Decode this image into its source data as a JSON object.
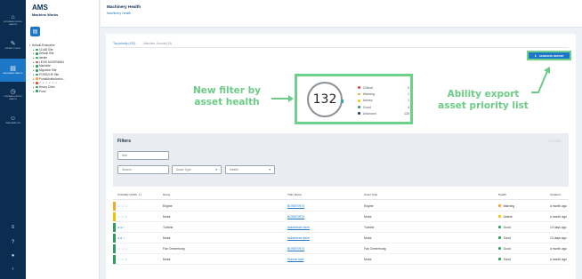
{
  "rail": {
    "items": [
      {
        "icon": "dashboard-icon",
        "glyph": "⌂",
        "label": "EXTENDED DEVICE HEALTH"
      },
      {
        "icon": "wrench-icon",
        "glyph": "✎",
        "label": "EXPERT STUDIO"
      },
      {
        "icon": "site-icon",
        "glyph": "▤",
        "label": "MACHINERY HEALTH"
      },
      {
        "icon": "gauge-icon",
        "glyph": "◷",
        "label": "PORTABLE DEVICE HEALTH"
      },
      {
        "icon": "people-icon",
        "glyph": "☺",
        "label": "USER ANALYSIS"
      }
    ],
    "bottom": [
      {
        "icon": "filter-icon",
        "glyph": "≡"
      },
      {
        "icon": "help-icon",
        "glyph": "?"
      },
      {
        "icon": "user-avatar-icon",
        "glyph": "●"
      },
      {
        "icon": "collapse-icon",
        "glyph": "‹"
      }
    ]
  },
  "brand": {
    "title": "AMS",
    "subtitle": "Machine Works"
  },
  "tree": {
    "toolbar_icon": "list-view-icon",
    "nodes": [
      {
        "label": "Default Enterprise",
        "dot": "",
        "level": 0
      },
      {
        "label": "111AB Site",
        "dot": "#2aa05a",
        "level": 1
      },
      {
        "label": "Default Site",
        "dot": "#2aa05a",
        "level": 1
      },
      {
        "label": "Iterate",
        "dot": "#2aa05a",
        "level": 1
      },
      {
        "label": "LEVIS ACKERMAN",
        "dot": "#d94b3a",
        "level": 1
      },
      {
        "label": "Machsite",
        "dot": "#2aa05a",
        "level": 1
      },
      {
        "label": "Migration Site",
        "dot": "#2aa05a",
        "level": 1
      },
      {
        "label": "PORSCHE Site",
        "dot": "#2aa05a",
        "level": 1
      },
      {
        "label": "PortalMobileArchiv...",
        "dot": "#f5a623",
        "level": 1
      },
      {
        "label": "✓ ✓ ✓ ✓ ✓ ✓",
        "dot": "#d94b3a",
        "level": 1
      },
      {
        "label": "Heavy Clinic",
        "dot": "#2aa05a",
        "level": 1
      },
      {
        "label": "Pond",
        "dot": "#2aa05a",
        "level": 1
      }
    ]
  },
  "header": {
    "title": "Machinery Health",
    "breadcrumb": "Machinery Health"
  },
  "tabs": [
    {
      "label": "Top priority (132)",
      "active": true
    },
    {
      "label": "Machine Journal (13)",
      "active": false
    }
  ],
  "generate_report": {
    "icon": "download-icon",
    "glyph": "⬇",
    "label": "GENERATE REPORT"
  },
  "summary": {
    "total": "132",
    "legend": [
      {
        "label": "Critical",
        "count": "0",
        "color": "#d94b3a"
      },
      {
        "label": "Warning",
        "count": "1",
        "color": "#f5a623"
      },
      {
        "label": "Advise",
        "count": "1",
        "color": "#f5c200"
      },
      {
        "label": "Good",
        "count": "4",
        "color": "#2aa05a"
      },
      {
        "label": "Unknown",
        "count": "126",
        "color": "#1c3d6e"
      }
    ]
  },
  "callouts": {
    "left": "New filter by asset health",
    "right": "Ability export asset priority list"
  },
  "filters": {
    "title": "Filters",
    "clear_label": "CLEAR",
    "chip_value": "Site",
    "search_placeholder": "Search",
    "asset_type_placeholder": "Asset Type",
    "health_placeholder": "Health"
  },
  "table": {
    "headers": [
      "Criticality (ASPL ⇩)",
      "Name",
      "Train Name",
      "Asset Type",
      "Health",
      "Updated"
    ],
    "rows": [
      {
        "bar": "#f5a623",
        "crit": "☆☆☆",
        "name": "Engine",
        "train": "BOSMTWT4",
        "type": "Engine",
        "health": "Warning",
        "hcolor": "#f5a623",
        "updated": "a month ago"
      },
      {
        "bar": "#f5c200",
        "crit": "☆☆☆",
        "name": "Motor",
        "train": "BOSMTWT4",
        "type": "Motor",
        "health": "Advise",
        "hcolor": "#f5c200",
        "updated": "a month ago"
      },
      {
        "bar": "#2aa05a",
        "crit": "●●○",
        "name": "Turbine",
        "train": "ladodntrain kwrh",
        "type": "Turbine",
        "health": "Good",
        "hcolor": "#2aa05a",
        "updated": "13 days ago"
      },
      {
        "bar": "#2aa05a",
        "crit": "●●○",
        "name": "Motor",
        "train": "ladodntrain kwrh",
        "type": "Motor",
        "health": "Good",
        "hcolor": "#2aa05a",
        "updated": "13 days ago"
      },
      {
        "bar": "#2aa05a",
        "crit": "☆☆☆",
        "name": "Fan Centerhung",
        "train": "BOSMTWT4",
        "type": "Fan Centerhung",
        "health": "Good",
        "hcolor": "#2aa05a",
        "updated": "a month ago"
      },
      {
        "bar": "#2aa05a",
        "crit": "☆☆☆",
        "name": "Motor",
        "train": "Normal train",
        "type": "Motor",
        "health": "Good",
        "hcolor": "#2aa05a",
        "updated": "a month ago"
      }
    ]
  },
  "colors": {
    "accent": "#1d77c7",
    "highlight": "#6fd08a",
    "rail": "#0c2d52"
  }
}
